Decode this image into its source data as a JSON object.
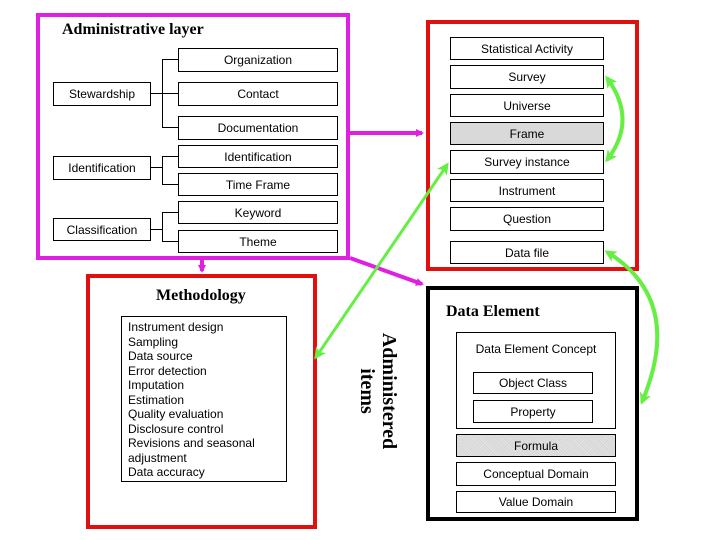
{
  "admin": {
    "title": "Administrative layer",
    "groups": [
      {
        "label": "Stewardship",
        "children": [
          "Organization",
          "Contact",
          "Documentation"
        ]
      },
      {
        "label": "Identification",
        "children": [
          "Identification",
          "Time Frame"
        ]
      },
      {
        "label": "Classification",
        "children": [
          "Keyword",
          "Theme"
        ]
      }
    ]
  },
  "stat": {
    "items": [
      "Statistical Activity",
      "Survey",
      "Universe",
      "Frame",
      "Survey instance",
      "Instrument",
      "Question",
      "Data file"
    ]
  },
  "methodology": {
    "title": "Methodology",
    "items": [
      "Instrument design",
      "Sampling",
      "Data source",
      "Error detection",
      "Imputation",
      "Estimation",
      "Quality evaluation",
      "Disclosure control",
      "Revisions and seasonal adjustment",
      "Data accuracy"
    ]
  },
  "administered": {
    "line1": "Administered",
    "line2": "items"
  },
  "data_element": {
    "title": "Data Element",
    "concept": "Data Element Concept",
    "concept_items": [
      "Object Class",
      "Property"
    ],
    "items": [
      "Formula",
      "Conceptual Domain",
      "Value Domain"
    ]
  },
  "colors": {
    "admin_frame": "#e020e0",
    "stat_frame": "#e01010",
    "method_frame": "#e01010",
    "data_frame": "#000000",
    "green_arrow": "#66ee44",
    "magenta_arrow": "#e020e0"
  }
}
